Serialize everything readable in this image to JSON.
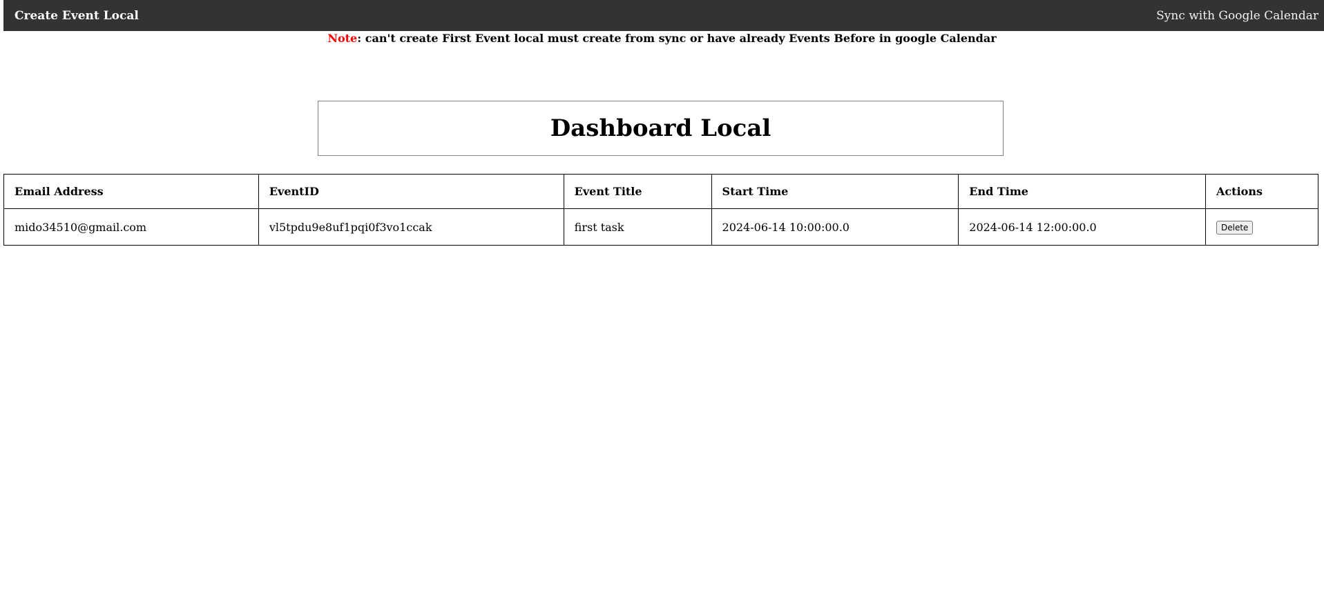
{
  "navbar": {
    "left_link": "Create Event Local",
    "right_link": "Sync with Google Calendar",
    "background": "#333333"
  },
  "note": {
    "label": "Note",
    "text": ": can't create First Event local must create from sync or have already Events Before in google Calendar",
    "label_color": "#ff0000"
  },
  "dashboard": {
    "title": "Dashboard Local"
  },
  "table": {
    "headers": [
      "Email Address",
      "EventID",
      "Event Title",
      "Start Time",
      "End Time",
      "Actions"
    ],
    "rows": [
      {
        "email": "mido34510@gmail.com",
        "event_id": "vl5tpdu9e8uf1pqi0f3vo1ccak",
        "title": "first task",
        "start": "2024-06-14 10:00:00.0",
        "end": "2024-06-14 12:00:00.0",
        "action": "Delete"
      }
    ]
  }
}
